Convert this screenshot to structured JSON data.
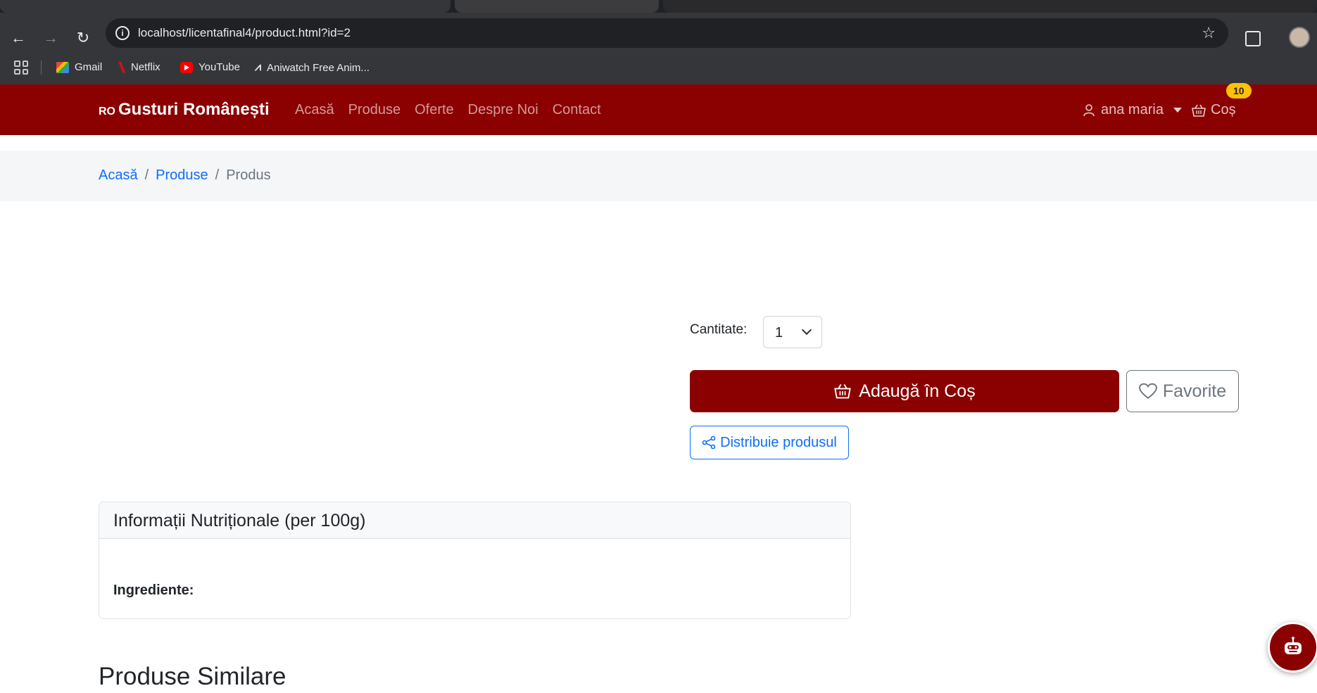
{
  "browser": {
    "url": "localhost/licentafinal4/product.html?id=2",
    "bookmarks": [
      "Gmail",
      "Netflix",
      "YouTube",
      "Aniwatch Free Anim..."
    ]
  },
  "navbar": {
    "brand_prefix": "RO",
    "brand": "Gusturi Românești",
    "links": [
      "Acasă",
      "Produse",
      "Oferte",
      "Despre Noi",
      "Contact"
    ],
    "user": "ana maria",
    "cart": "Coș",
    "cart_count": "10"
  },
  "breadcrumb": {
    "home": "Acasă",
    "products": "Produse",
    "current": "Produs",
    "separator": "/"
  },
  "product": {
    "quantity_label": "Cantitate:",
    "quantity_value": "1",
    "add_to_cart": "Adaugă în Coș",
    "favorite": "Favorite",
    "share": "Distribuie produsul"
  },
  "nutrition": {
    "title": "Informații Nutriționale (per 100g)",
    "ingredients_label": "Ingrediente:"
  },
  "similar": {
    "title": "Produse Similare"
  },
  "colors": {
    "brand": "#8b0000",
    "link": "#0d6efd",
    "badge": "#ffc107"
  }
}
